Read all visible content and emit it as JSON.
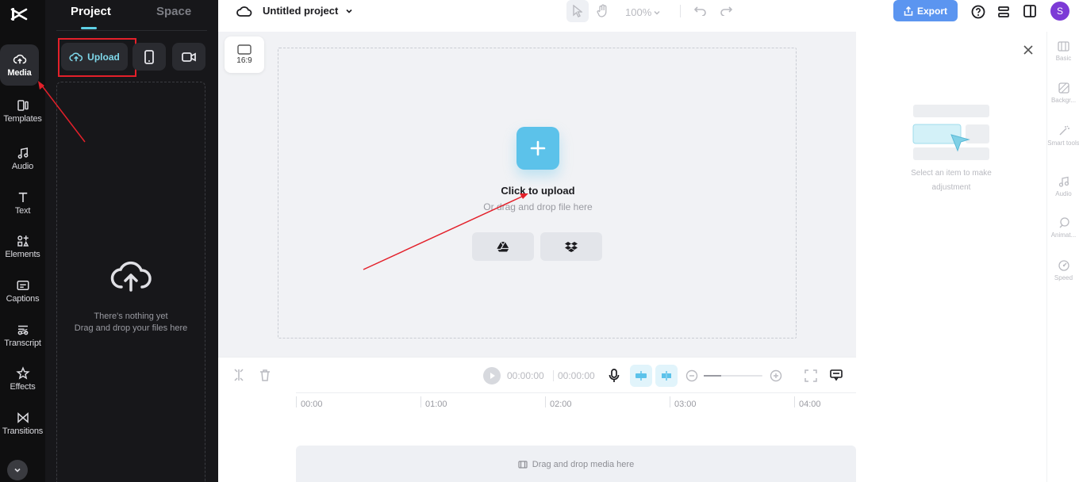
{
  "rail": {
    "items": [
      {
        "label": "Media",
        "icon": "cloud-upload-icon"
      },
      {
        "label": "Templates",
        "icon": "templates-icon"
      },
      {
        "label": "Audio",
        "icon": "music-note-icon"
      },
      {
        "label": "Text",
        "icon": "text-icon"
      },
      {
        "label": "Elements",
        "icon": "elements-icon"
      },
      {
        "label": "Captions",
        "icon": "captions-icon"
      },
      {
        "label": "Transcript",
        "icon": "transcript-icon"
      },
      {
        "label": "Effects",
        "icon": "effects-icon"
      },
      {
        "label": "Transitions",
        "icon": "transitions-icon"
      }
    ]
  },
  "panel": {
    "tabs": [
      "Project",
      "Space"
    ],
    "upload_label": "Upload",
    "empty_line1": "There's nothing yet",
    "empty_line2": "Drag and drop your files here"
  },
  "header": {
    "project_title": "Untitled project",
    "zoom": "100%",
    "export_label": "Export",
    "avatar_letter": "S"
  },
  "canvas": {
    "ratio": "16:9",
    "click_title": "Click to upload",
    "click_sub": "Or drag and drop file here"
  },
  "timeline": {
    "current_time": "00:00:00",
    "total_time": "00:00:00",
    "ticks": [
      "00:00",
      "01:00",
      "02:00",
      "03:00",
      "04:00"
    ],
    "drop_label": "Drag and drop media here"
  },
  "properties": {
    "empty_line1": "Select an item to make",
    "empty_line2": "adjustment"
  },
  "right_rail": {
    "items": [
      "Basic",
      "Backgr...",
      "Smart tools",
      "Audio",
      "Animat...",
      "Speed"
    ]
  },
  "colors": {
    "accent": "#5cc2ea",
    "export": "#5b95f0",
    "annotation": "#e3202a"
  }
}
